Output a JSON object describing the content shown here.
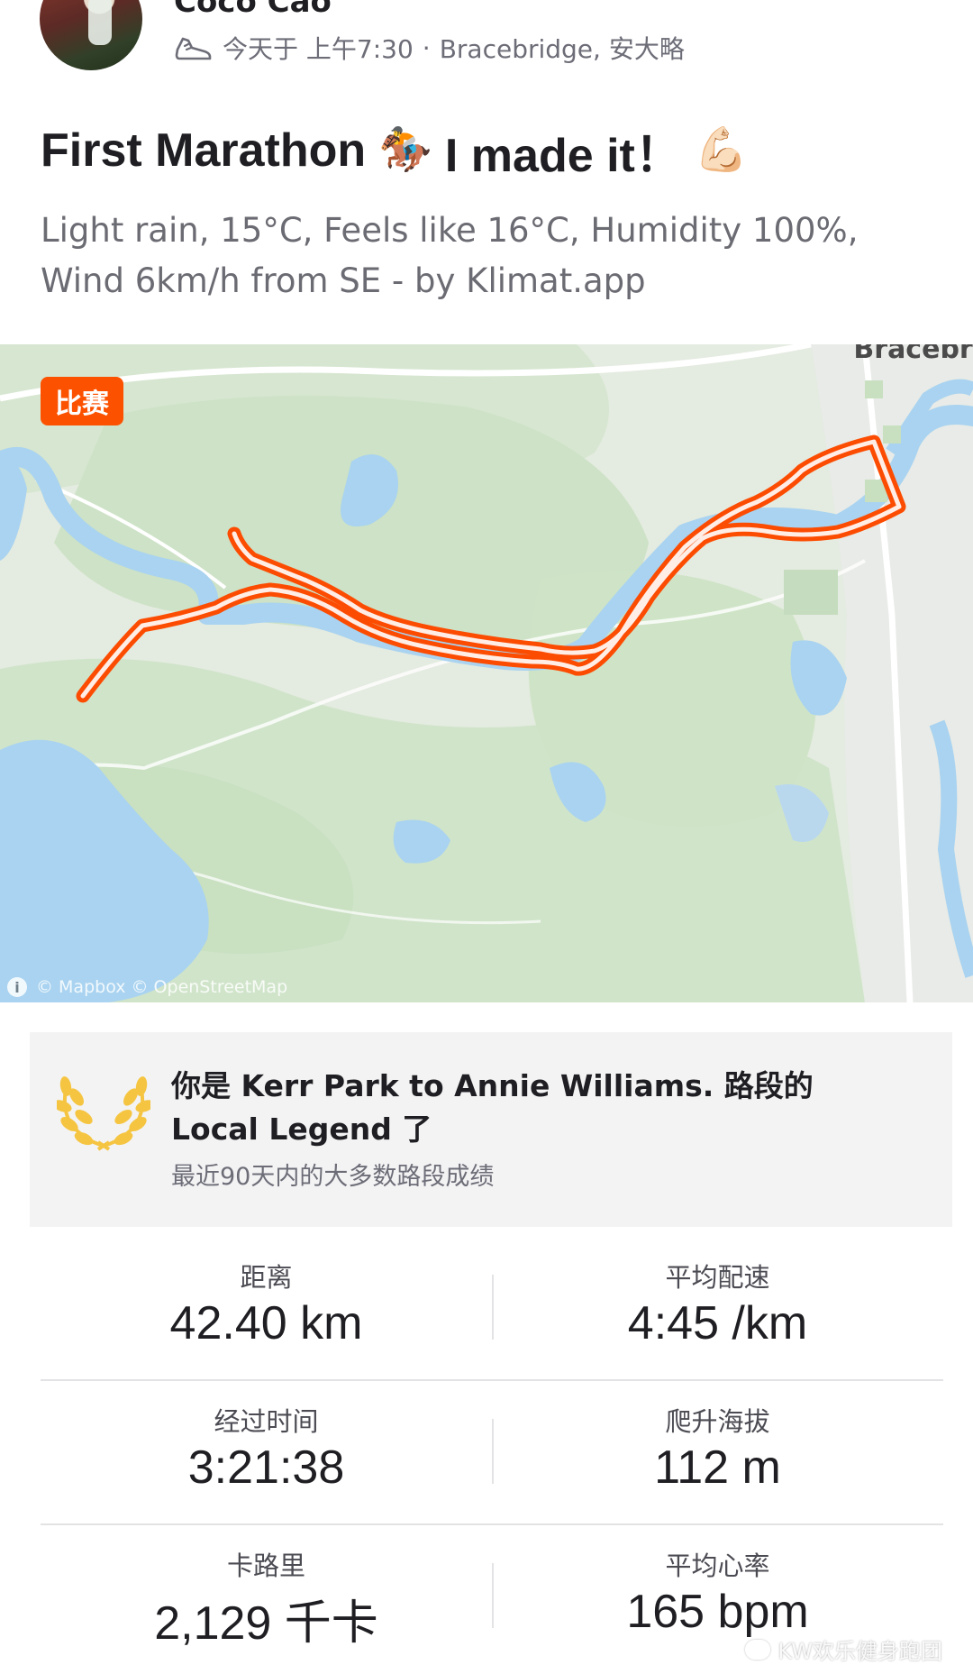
{
  "header": {
    "user_name": "Coco Cao",
    "timestamp": "今天于 上午7:30",
    "separator": "·",
    "location": "Bracebridge, 安大略",
    "activity_icon": "running-shoe-icon"
  },
  "activity": {
    "title_part1": "First Marathon",
    "emoji_horse": "🏇",
    "title_part2": "I made it！",
    "emoji_muscle": "💪🏻",
    "description": "Light rain, 15°C, Feels like 16°C, Humidity 100%, Wind 6km/h from SE - by Klimat.app"
  },
  "map": {
    "badge": "比赛",
    "place_label": "Bracebri",
    "credit": "© Mapbox © OpenStreetMap",
    "info_glyph": "i"
  },
  "local_legend": {
    "title": "你是 Kerr Park to Annie Williams. 路段的 Local Legend 了",
    "subtitle": "最近90天内的大多数路段成绩",
    "icon": "laurel-wreath-icon"
  },
  "stats": [
    {
      "left_label": "距离",
      "left_value": "42.40 km",
      "right_label": "平均配速",
      "right_value": "4:45 /km"
    },
    {
      "left_label": "经过时间",
      "left_value": "3:21:38",
      "right_label": "爬升海拔",
      "right_value": "112 m"
    },
    {
      "left_label": "卡路里",
      "left_value": "2,129 千卡",
      "right_label": "平均心率",
      "right_value": "165 bpm"
    }
  ],
  "watermark": "KW欢乐健身跑团",
  "colors": {
    "accent": "#fc5200",
    "route": "#fc4c02",
    "water": "#a9d3f0",
    "land": "#cfe3c8"
  }
}
